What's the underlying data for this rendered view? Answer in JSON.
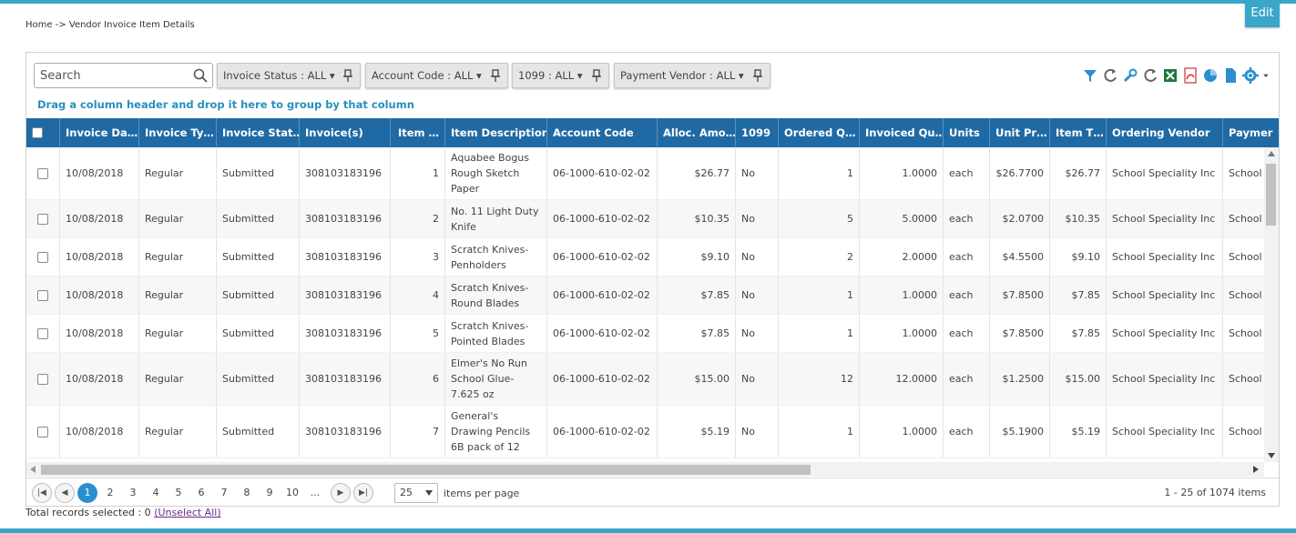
{
  "breadcrumb": "Home -> Vendor Invoice Item Details",
  "edit_label": "Edit",
  "search": {
    "placeholder": "Search"
  },
  "filters": [
    {
      "label": "Invoice Status : ALL ▾"
    },
    {
      "label": "Account Code : ALL ▾"
    },
    {
      "label": "1099 : ALL ▾"
    },
    {
      "label": "Payment Vendor : ALL ▾"
    }
  ],
  "toolbar_icons": [
    "filter-icon",
    "refresh-icon",
    "wrench-icon",
    "refresh-icon",
    "excel-icon",
    "pdf-icon",
    "chart-icon",
    "document-icon",
    "gear-icon"
  ],
  "group_hint": "Drag a column header and drop it here to group by that column",
  "columns": [
    "Invoice Da…",
    "Invoice Ty…",
    "Invoice Stat…",
    "Invoice(s)",
    "Item …",
    "Item Description",
    "Account Code",
    "Alloc. Amo…",
    "1099",
    "Ordered Q…",
    "Invoiced Qu…",
    "Units",
    "Unit Pr…",
    "Item T…",
    "Ordering Vendor",
    "Paymer"
  ],
  "rows": [
    [
      "10/08/2018",
      "Regular",
      "Submitted",
      "308103183196",
      "1",
      "Aquabee Bogus Rough Sketch Paper",
      "06-1000-610-02-02",
      "$26.77",
      "No",
      "1",
      "1.0000",
      "each",
      "$26.7700",
      "$26.77",
      "School Speciality Inc",
      "School"
    ],
    [
      "10/08/2018",
      "Regular",
      "Submitted",
      "308103183196",
      "2",
      "No. 11 Light Duty Knife",
      "06-1000-610-02-02",
      "$10.35",
      "No",
      "5",
      "5.0000",
      "each",
      "$2.0700",
      "$10.35",
      "School Speciality Inc",
      "School"
    ],
    [
      "10/08/2018",
      "Regular",
      "Submitted",
      "308103183196",
      "3",
      "Scratch Knives-Penholders",
      "06-1000-610-02-02",
      "$9.10",
      "No",
      "2",
      "2.0000",
      "each",
      "$4.5500",
      "$9.10",
      "School Speciality Inc",
      "School"
    ],
    [
      "10/08/2018",
      "Regular",
      "Submitted",
      "308103183196",
      "4",
      "Scratch Knives-Round Blades",
      "06-1000-610-02-02",
      "$7.85",
      "No",
      "1",
      "1.0000",
      "each",
      "$7.8500",
      "$7.85",
      "School Speciality Inc",
      "School"
    ],
    [
      "10/08/2018",
      "Regular",
      "Submitted",
      "308103183196",
      "5",
      "Scratch Knives-Pointed Blades",
      "06-1000-610-02-02",
      "$7.85",
      "No",
      "1",
      "1.0000",
      "each",
      "$7.8500",
      "$7.85",
      "School Speciality Inc",
      "School"
    ],
    [
      "10/08/2018",
      "Regular",
      "Submitted",
      "308103183196",
      "6",
      "Elmer's No Run School Glue-7.625 oz",
      "06-1000-610-02-02",
      "$15.00",
      "No",
      "12",
      "12.0000",
      "each",
      "$1.2500",
      "$15.00",
      "School Speciality Inc",
      "School"
    ],
    [
      "10/08/2018",
      "Regular",
      "Submitted",
      "308103183196",
      "7",
      "General's Drawing Pencils 6B pack of 12",
      "06-1000-610-02-02",
      "$5.19",
      "No",
      "1",
      "1.0000",
      "each",
      "$5.1900",
      "$5.19",
      "School Speciality Inc",
      "School"
    ]
  ],
  "pager": {
    "pages": [
      "1",
      "2",
      "3",
      "4",
      "5",
      "6",
      "7",
      "8",
      "9",
      "10",
      "..."
    ],
    "current_page": "1",
    "page_size": "25",
    "items_per_page_label": "items per page",
    "range_label": "1 - 25 of 1074 items"
  },
  "footer": {
    "selected_label": "Total records selected : 0",
    "unselect_label": "(Unselect All)"
  }
}
